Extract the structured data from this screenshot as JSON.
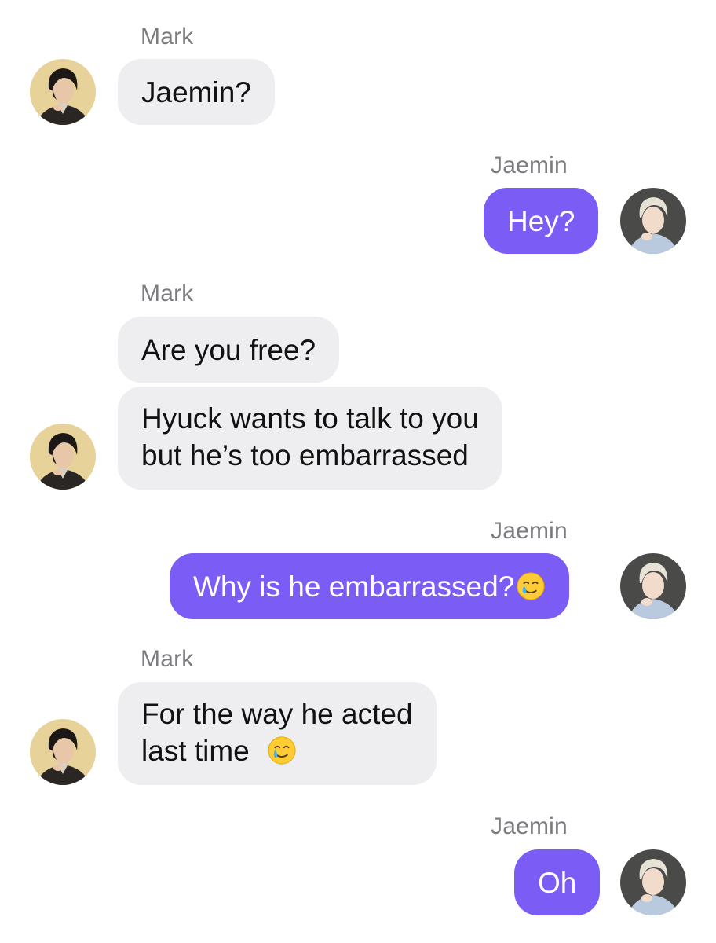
{
  "conversation": {
    "messages": [
      {
        "sender": "Mark",
        "side": "in",
        "text": "Jaemin?"
      },
      {
        "sender": "Jaemin",
        "side": "out",
        "text": "Hey?"
      },
      {
        "sender": "Mark",
        "side": "in",
        "text": "Are you free?"
      },
      {
        "sender": "Mark",
        "side": "in",
        "lines": [
          "Hyuck wants to talk to you",
          "but he’s too embarrassed"
        ]
      },
      {
        "sender": "Jaemin",
        "side": "out",
        "text": "Why is he embarrassed?",
        "emoji": "smiling-face-with-tear"
      },
      {
        "sender": "Mark",
        "side": "in",
        "lines": [
          "For the way he acted",
          "last time"
        ],
        "emoji": "smiling-face-with-tear"
      },
      {
        "sender": "Jaemin",
        "side": "out",
        "text": "Oh"
      }
    ]
  },
  "colors": {
    "incoming_bubble": "#eeeef1",
    "outgoing_bubble": "#7b5cf5",
    "sender_name": "#7c7c80"
  }
}
